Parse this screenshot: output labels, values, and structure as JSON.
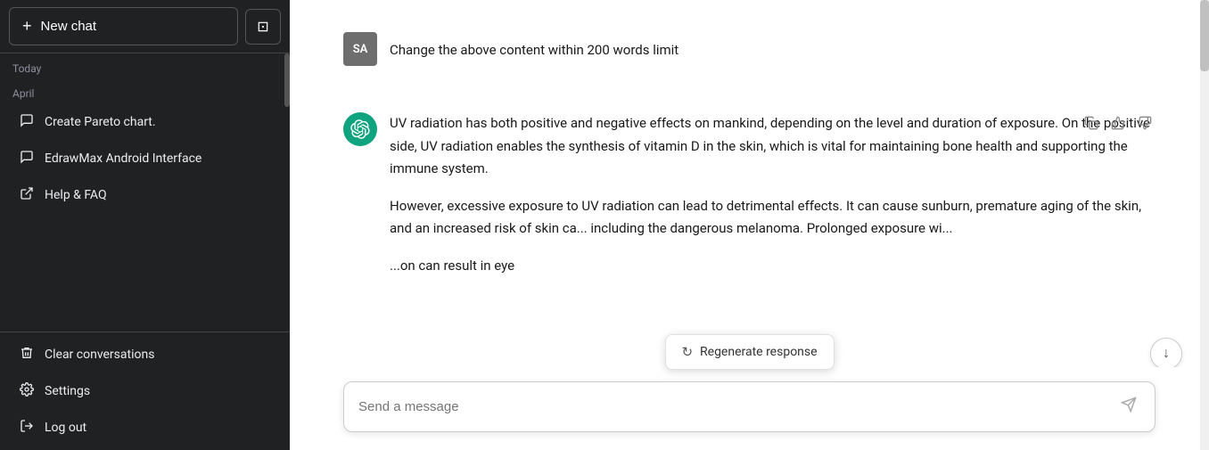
{
  "sidebar": {
    "new_chat_label": "New chat",
    "collapse_icon": "⊞",
    "today_label": "Today",
    "april_label": "April",
    "items": [
      {
        "id": "create-pareto",
        "icon": "💬",
        "label": "Create Pareto chart."
      },
      {
        "id": "edrawmax-android",
        "icon": "💬",
        "label": "EdrawMax Android Interface"
      },
      {
        "id": "help-faq",
        "icon": "↗",
        "label": "Help & FAQ"
      }
    ],
    "bottom_items": [
      {
        "id": "clear-conversations",
        "icon": "🗑",
        "label": "Clear conversations"
      },
      {
        "id": "settings",
        "icon": "⚙",
        "label": "Settings"
      },
      {
        "id": "log-out",
        "icon": "↪",
        "label": "Log out"
      }
    ]
  },
  "chat": {
    "user_avatar": "SA",
    "user_message": "Change the above content within 200 words limit",
    "ai_response_p1": "UV radiation has both positive and negative effects on mankind, depending on the level and duration of exposure. On the positive side, UV radiation enables the synthesis of vitamin D in the skin, which is vital for maintaining bone health and supporting the immune system.",
    "ai_response_p2": "However, excessive exposure to UV radiation can lead to detrimental effects. It can cause sunburn, premature aging of the skin, and an increased risk of skin ca... including the dangerous melanoma. Prolonged exposure wi...",
    "ai_response_p3": "...on can result in eye"
  },
  "input": {
    "placeholder": "Send a message"
  },
  "regenerate": {
    "label": "Regenerate response",
    "icon": "↻"
  },
  "actions": {
    "copy_icon": "⧉",
    "thumbs_up_icon": "👍",
    "thumbs_down_icon": "👎"
  },
  "scroll_down_icon": "↓"
}
